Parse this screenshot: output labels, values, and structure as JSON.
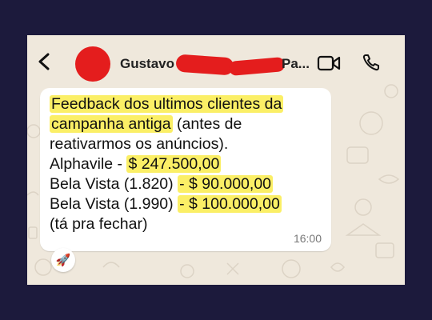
{
  "header": {
    "contact_name": "Gustavo",
    "contact_tail": "Pa...",
    "icons": [
      "back-arrow-icon",
      "video-call-icon",
      "voice-call-icon"
    ]
  },
  "message": {
    "lines": [
      {
        "text": "Feedback dos ultimos clientes da"
      },
      {
        "text_hl": "campanha antiga",
        "text": " (antes de"
      },
      {
        "text": "reativarmos os anúncios)."
      },
      {
        "text": "Alphavile - ",
        "text_hl": "$ 247.500,00"
      },
      {
        "text": "Bela Vista (1.820) ",
        "text_hl": "- $ 90.000,00"
      },
      {
        "text": "Bela Vista (1.990) ",
        "text_hl": "- $ 100.000,00"
      },
      {
        "text": "(tá pra fechar)"
      }
    ],
    "time": "16:00"
  },
  "reaction": {
    "emoji": "🚀"
  },
  "colors": {
    "frame": "#1c1a3c",
    "chat_bg": "#efe8dc",
    "bubble": "#ffffff",
    "highlight": "#fbef66",
    "redaction": "#e41d1d"
  }
}
